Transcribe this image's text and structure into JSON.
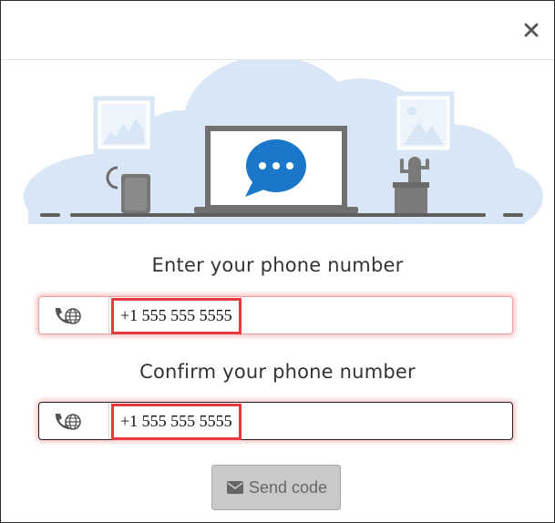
{
  "dialog": {
    "close_icon": "close-icon",
    "illustration": {
      "description_icons": [
        "window-frame",
        "mug",
        "laptop",
        "chat-bubble-icon",
        "potted-cactus",
        "picture-frame"
      ],
      "accent_color": "#1a77c9",
      "cloud_color": "#d8e6f6"
    },
    "phone_heading": "Enter your phone number",
    "phone_value": "+1 555 555 5555",
    "confirm_heading": "Confirm your phone number",
    "confirm_value": "+1 555 555 5555",
    "field_icon": "phone-globe-icon",
    "send_button_label": "Send code",
    "send_button_icon": "envelope-icon",
    "highlight_color": "#e8393f"
  }
}
